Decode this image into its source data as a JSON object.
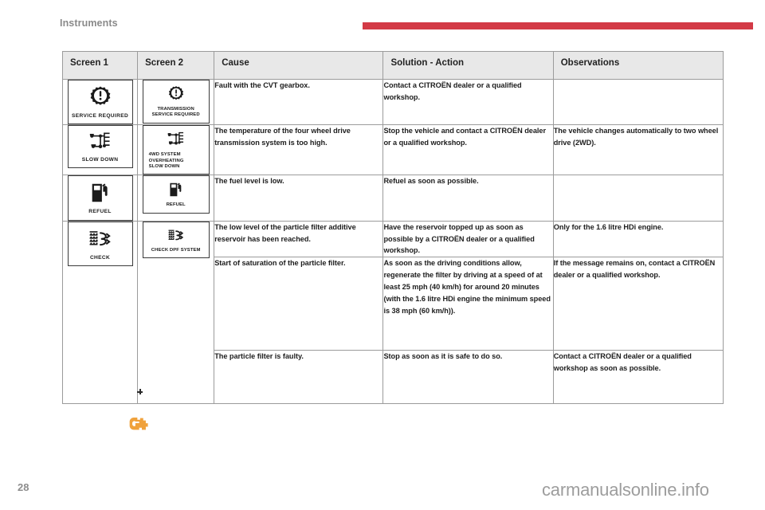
{
  "header": {
    "section_title": "Instruments",
    "rule_color": "#d33a46"
  },
  "table": {
    "columns": [
      "Screen 1",
      "Screen 2",
      "Cause",
      "Solution - Action",
      "Observations"
    ],
    "rows": [
      {
        "screen1": {
          "icon": "gear-warning-icon",
          "label": "SERVICE REQUIRED"
        },
        "screen2": {
          "icon": "gear-warning-icon",
          "label": "TRANSMISSION\nSERVICE REQUIRED"
        },
        "cause": "Fault with the CVT gearbox.",
        "solution": "Contact a CITROËN dealer or a qualified workshop.",
        "observations": ""
      },
      {
        "screen1": {
          "icon": "four-wheel-drive-icon",
          "label": "SLOW DOWN"
        },
        "screen2": {
          "icon": "four-wheel-drive-icon",
          "label": "4WD SYSTEM OVERHEATING\nSLOW DOWN"
        },
        "cause": "The temperature of the four wheel drive transmission system is too high.",
        "solution": "Stop the vehicle and contact a CITROËN dealer or a qualified workshop.",
        "observations": "The vehicle changes automatically to two wheel drive (2WD)."
      },
      {
        "screen1": {
          "icon": "fuel-pump-icon",
          "label": "REFUEL"
        },
        "screen2": {
          "icon": "fuel-pump-icon",
          "label": "REFUEL"
        },
        "cause": "The fuel level is low.",
        "solution": "Refuel as soon as possible.",
        "observations": ""
      },
      {
        "screen1": {
          "icon": "particle-filter-icon",
          "label": "CHECK"
        },
        "screen2": {
          "icon": "particle-filter-icon",
          "label": "CHECK DPF SYSTEM"
        },
        "cause": "The low level of the particle filter additive reservoir has been reached.",
        "solution": "Have the reservoir topped up as soon as possible by a CITROËN dealer or a qualified workshop.",
        "observations": "Only for the 1.6 litre HDi engine."
      },
      {
        "screen1": null,
        "screen2": null,
        "cause": "Start of saturation of the particle filter.",
        "solution": "As soon as the driving conditions allow, regenerate the filter by driving at a speed of at least 25 mph (40 km/h) for around 20 minutes (with the 1.6 litre HDi engine the minimum speed is 38 mph (60 km/h)).",
        "observations": "If the message remains on, contact a CITROËN dealer or a qualified workshop."
      },
      {
        "screen1": null,
        "screen2": null,
        "cause": "The particle filter is faulty.",
        "solution": "Stop as soon as it is safe to do so.",
        "observations": "Contact a CITROËN dealer or a qualified workshop as soon as possible."
      }
    ]
  },
  "annotations": {
    "engine_warning_icon": "engine-check-icon",
    "engine_warning_color": "#f0a23c",
    "cross_marker": "cross-marker"
  },
  "footer": {
    "page_number": "28",
    "watermark": "carmanualsonline.info"
  }
}
